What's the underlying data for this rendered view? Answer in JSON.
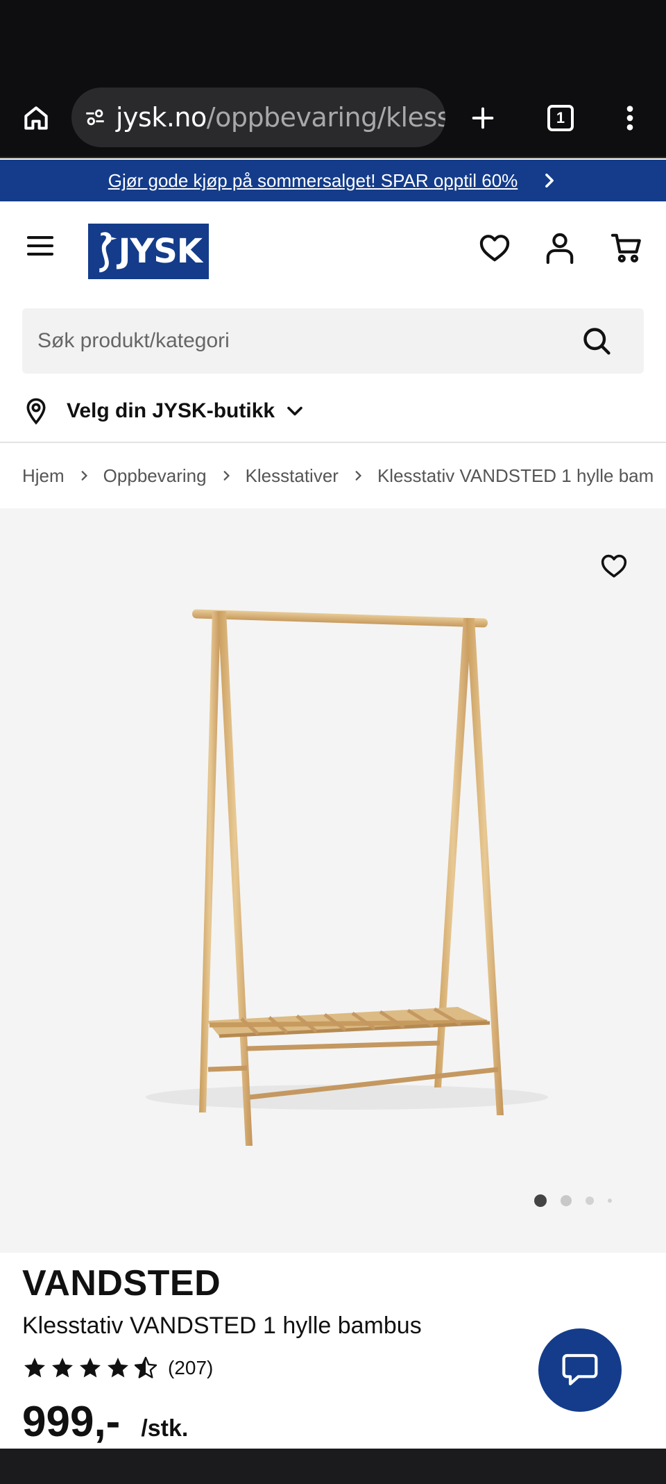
{
  "browser": {
    "url_host": "jysk.no",
    "url_path": "/oppbevaring/klesst",
    "tab_count": "1"
  },
  "promo": {
    "text": "Gjør gode kjøp på sommersalget! SPAR opptil 60%"
  },
  "header": {
    "logo_text": "JYSK"
  },
  "search": {
    "placeholder": "Søk produkt/kategori"
  },
  "store": {
    "label": "Velg din JYSK-butikk"
  },
  "breadcrumb": {
    "items": [
      "Hjem",
      "Oppbevaring",
      "Klesstativer",
      "Klesstativ VANDSTED 1 hylle bam"
    ]
  },
  "gallery": {
    "image_count": 4,
    "active_index": 0
  },
  "product": {
    "brand": "VANDSTED",
    "name": "Klesstativ VANDSTED 1 hylle bambus",
    "rating": 4.5,
    "rating_count": "(207)",
    "price": "999,-",
    "unit": "/stk."
  },
  "colors": {
    "brand_blue": "#143c8a",
    "chrome_dark": "#0e0e10",
    "bamboo": "#d9b57a"
  }
}
